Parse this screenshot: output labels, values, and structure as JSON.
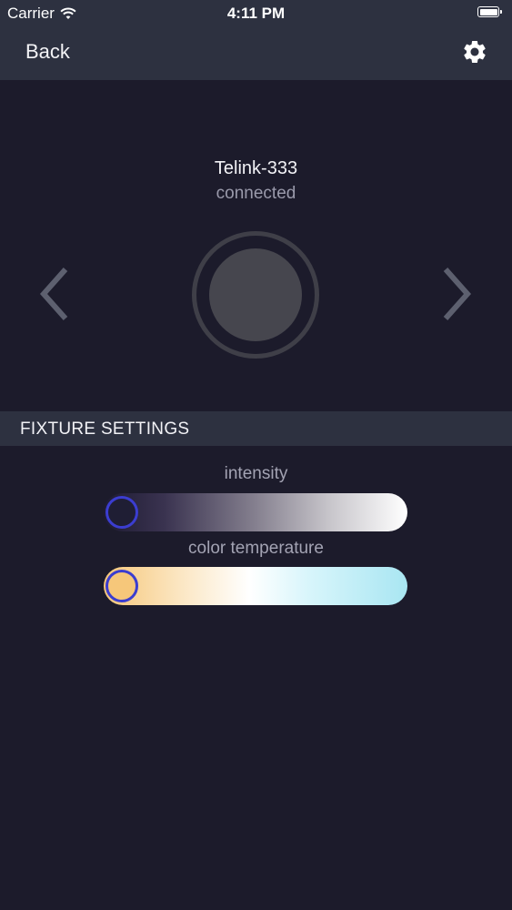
{
  "status_bar": {
    "carrier": "Carrier",
    "time": "4:11 PM"
  },
  "nav": {
    "back_label": "Back",
    "settings_icon": "gear-icon"
  },
  "device": {
    "name": "Telink-333",
    "status": "connected"
  },
  "section": {
    "title": "FIXTURE SETTINGS"
  },
  "sliders": {
    "intensity": {
      "label": "intensity",
      "value": 0
    },
    "color_temperature": {
      "label": "color temperature",
      "value": 0
    }
  },
  "colors": {
    "background": "#1c1b2b",
    "bar": "#2d3140",
    "thumb_border": "#3b3dd0",
    "warm": "#f6c77a",
    "cool": "#a9e6f2"
  }
}
